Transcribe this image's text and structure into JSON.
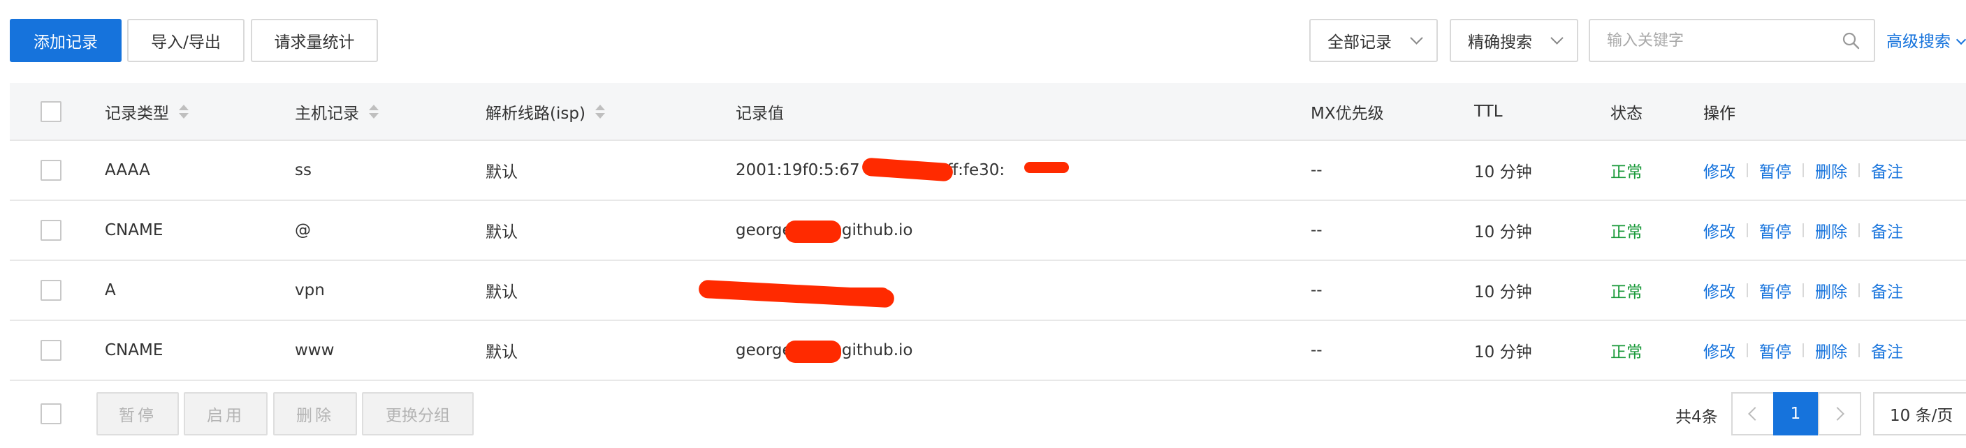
{
  "toolbar": {
    "add_record": "添加记录",
    "import_export": "导入/导出",
    "stats": "请求量统计",
    "filter_all": "全部记录",
    "search_mode": "精确搜索",
    "search_placeholder": "输入关键字",
    "advanced_search": "高级搜索"
  },
  "table": {
    "columns": [
      "记录类型",
      "主机记录",
      "解析线路(isp)",
      "记录值",
      "MX优先级",
      "TTL",
      "状态",
      "操作"
    ],
    "actions": [
      "修改",
      "暂停",
      "删除",
      "备注"
    ],
    "rows": [
      {
        "type": "AAAA",
        "host": "ss",
        "line": "默认",
        "value": "2001:19f0:5:67",
        "value_suffix": "2ff:fe30:",
        "mx": "--",
        "ttl": "10 分钟",
        "status": "正常"
      },
      {
        "type": "CNAME",
        "host": "@",
        "line": "默认",
        "value": "george",
        "value_suffix": ".github.io",
        "mx": "--",
        "ttl": "10 分钟",
        "status": "正常"
      },
      {
        "type": "A",
        "host": "vpn",
        "line": "默认",
        "value": "",
        "value_suffix": "",
        "mx": "--",
        "ttl": "10 分钟",
        "status": "正常"
      },
      {
        "type": "CNAME",
        "host": "www",
        "line": "默认",
        "value": "george",
        "value_suffix": ".github.io",
        "mx": "--",
        "ttl": "10 分钟",
        "status": "正常"
      }
    ]
  },
  "footer": {
    "pause": "暂停",
    "enable": "启用",
    "delete": "删除",
    "change_group": "更换分组",
    "total": "共4条",
    "current_page": "1",
    "page_size": "10 条/页"
  },
  "colors": {
    "primary": "#1673dc",
    "status_ok": "#1a9a3a",
    "redaction": "#ff2a00"
  }
}
